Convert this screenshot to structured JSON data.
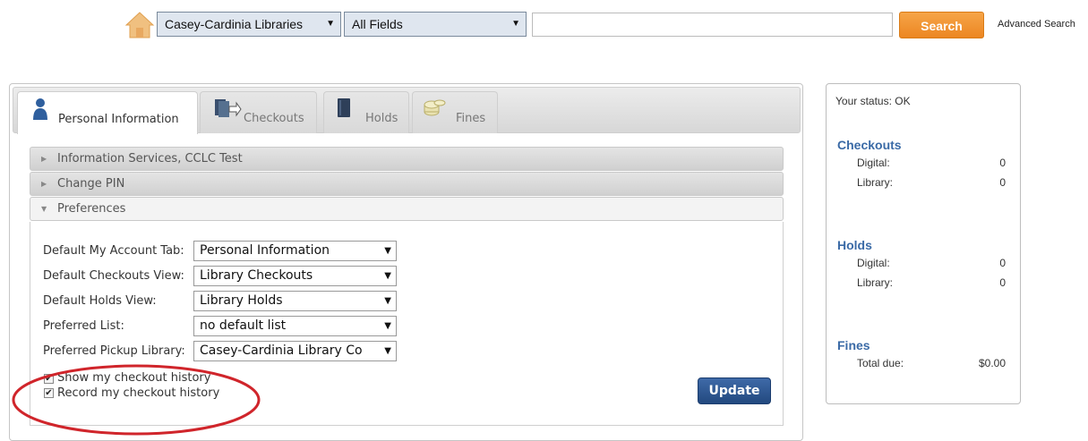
{
  "search": {
    "library_select": "Casey-Cardinia Libraries",
    "field_select": "All Fields",
    "query": "",
    "button": "Search",
    "advanced": "Advanced Search"
  },
  "tabs": [
    {
      "label": "Personal Information",
      "icon": "person-icon",
      "active": true
    },
    {
      "label": "Checkouts",
      "icon": "checkout-icon",
      "active": false
    },
    {
      "label": "Holds",
      "icon": "book-icon",
      "active": false
    },
    {
      "label": "Fines",
      "icon": "coins-icon",
      "active": false
    }
  ],
  "accordion": [
    {
      "label": "Information Services, CCLC Test",
      "open": false
    },
    {
      "label": "Change PIN",
      "open": false
    },
    {
      "label": "Preferences",
      "open": true
    }
  ],
  "preferences": [
    {
      "label": "Default My Account Tab:",
      "value": "Personal Information"
    },
    {
      "label": "Default Checkouts View:",
      "value": "Library Checkouts"
    },
    {
      "label": "Default Holds View:",
      "value": "Library Holds"
    },
    {
      "label": "Preferred List:",
      "value": "no default list"
    },
    {
      "label": "Preferred Pickup Library:",
      "value": "Casey-Cardinia Library Co"
    }
  ],
  "checkboxes": [
    {
      "label": "Show my checkout history",
      "checked": true
    },
    {
      "label": "Record my checkout history",
      "checked": true
    }
  ],
  "update_button": "Update",
  "status": {
    "text": "Your status: OK",
    "checkouts": {
      "title": "Checkouts",
      "digital_label": "Digital:",
      "digital": "0",
      "library_label": "Library:",
      "library": "0"
    },
    "holds": {
      "title": "Holds",
      "digital_label": "Digital:",
      "digital": "0",
      "library_label": "Library:",
      "library": "0"
    },
    "fines": {
      "title": "Fines",
      "total_label": "Total due:",
      "total": "$0.00"
    }
  },
  "colors": {
    "search_button": "#ec8622",
    "update_button": "#23497f",
    "status_heading": "#3a6aa6",
    "highlight_ellipse": "#d0252b"
  }
}
